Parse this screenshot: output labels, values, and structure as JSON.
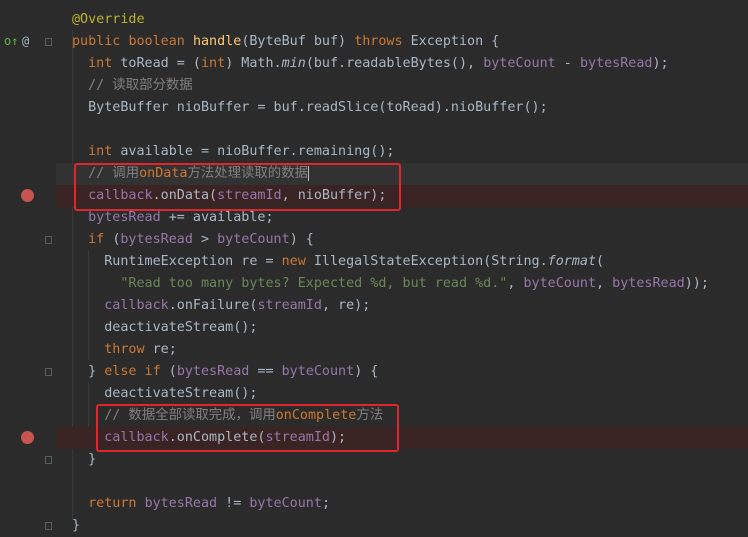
{
  "editor": {
    "lines": [
      {
        "segments": [
          {
            "t": "@Override",
            "c": "ann"
          }
        ]
      },
      {
        "segments": [
          {
            "t": "public ",
            "c": "kw"
          },
          {
            "t": "boolean ",
            "c": "kw"
          },
          {
            "t": "handle",
            "c": "fn"
          },
          {
            "t": "(ByteBuf buf) "
          },
          {
            "t": "throws ",
            "c": "kw"
          },
          {
            "t": "Exception {"
          }
        ]
      },
      {
        "segments": [
          {
            "t": "  int ",
            "c": "kw"
          },
          {
            "t": "toRead = ("
          },
          {
            "t": "int",
            "c": "kw"
          },
          {
            "t": ") Math."
          },
          {
            "t": "min",
            "c": "it"
          },
          {
            "t": "(buf.readableBytes(), "
          },
          {
            "t": "byteCount",
            "c": "fld"
          },
          {
            "t": " - "
          },
          {
            "t": "bytesRead",
            "c": "fld"
          },
          {
            "t": ");"
          }
        ]
      },
      {
        "segments": [
          {
            "t": "  // 读取部分数据",
            "c": "cm"
          }
        ]
      },
      {
        "segments": [
          {
            "t": "  ByteBuffer nioBuffer = buf.readSlice(toRead).nioBuffer();"
          }
        ]
      },
      {
        "segments": [
          {
            "t": ""
          }
        ]
      },
      {
        "segments": [
          {
            "t": "  int ",
            "c": "kw"
          },
          {
            "t": "available = nioBuffer.remaining();"
          }
        ]
      },
      {
        "segments": [
          {
            "t": "  // 调用",
            "c": "cm"
          },
          {
            "t": "onData",
            "c": "kw"
          },
          {
            "t": "方法处理读取的数据",
            "c": "cm"
          }
        ],
        "caret": true
      },
      {
        "segments": [
          {
            "t": "  callback",
            "c": "fld"
          },
          {
            "t": ".onData("
          },
          {
            "t": "streamId",
            "c": "fld"
          },
          {
            "t": ", nioBuffer);"
          }
        ],
        "breakpoint": true
      },
      {
        "segments": [
          {
            "t": "  bytesRead",
            "c": "fld"
          },
          {
            "t": " += available;"
          }
        ]
      },
      {
        "segments": [
          {
            "t": "  if ",
            "c": "kw"
          },
          {
            "t": "("
          },
          {
            "t": "bytesRead",
            "c": "fld"
          },
          {
            "t": " > "
          },
          {
            "t": "byteCount",
            "c": "fld"
          },
          {
            "t": ") {"
          }
        ]
      },
      {
        "segments": [
          {
            "t": "    RuntimeException re = "
          },
          {
            "t": "new ",
            "c": "kw"
          },
          {
            "t": "IllegalStateException(String."
          },
          {
            "t": "format",
            "c": "it"
          },
          {
            "t": "("
          }
        ]
      },
      {
        "segments": [
          {
            "t": "      \"Read too many bytes? Expected %d, but read %d.\"",
            "c": "str"
          },
          {
            "t": ", "
          },
          {
            "t": "byteCount",
            "c": "fld"
          },
          {
            "t": ", "
          },
          {
            "t": "bytesRead",
            "c": "fld"
          },
          {
            "t": "));"
          }
        ]
      },
      {
        "segments": [
          {
            "t": "    callback",
            "c": "fld"
          },
          {
            "t": ".onFailure("
          },
          {
            "t": "streamId",
            "c": "fld"
          },
          {
            "t": ", re);"
          }
        ]
      },
      {
        "segments": [
          {
            "t": "    deactivateStream();"
          }
        ]
      },
      {
        "segments": [
          {
            "t": "    throw ",
            "c": "kw"
          },
          {
            "t": "re;"
          }
        ]
      },
      {
        "segments": [
          {
            "t": "  } "
          },
          {
            "t": "else if ",
            "c": "kw"
          },
          {
            "t": "("
          },
          {
            "t": "bytesRead",
            "c": "fld"
          },
          {
            "t": " == "
          },
          {
            "t": "byteCount",
            "c": "fld"
          },
          {
            "t": ") {"
          }
        ]
      },
      {
        "segments": [
          {
            "t": "    deactivateStream();"
          }
        ]
      },
      {
        "segments": [
          {
            "t": "    // 数据全部读取完成，调用",
            "c": "cm"
          },
          {
            "t": "onComplete",
            "c": "kw"
          },
          {
            "t": "方法",
            "c": "cm"
          }
        ]
      },
      {
        "segments": [
          {
            "t": "    callback",
            "c": "fld"
          },
          {
            "t": ".onComplete("
          },
          {
            "t": "streamId",
            "c": "fld"
          },
          {
            "t": ");"
          }
        ],
        "breakpoint": true
      },
      {
        "segments": [
          {
            "t": "  }"
          }
        ]
      },
      {
        "segments": [
          {
            "t": ""
          }
        ]
      },
      {
        "segments": [
          {
            "t": "  return ",
            "c": "kw"
          },
          {
            "t": "bytesRead",
            "c": "fld"
          },
          {
            "t": " != "
          },
          {
            "t": "byteCount",
            "c": "fld"
          },
          {
            "t": ";"
          }
        ]
      },
      {
        "segments": [
          {
            "t": "}"
          }
        ]
      }
    ]
  },
  "gutter": {
    "override_icon": "override-implementing-icon",
    "annotation_icon": "@",
    "breakpoint_color": "#c75450"
  },
  "highlight_color": "#e0252c"
}
